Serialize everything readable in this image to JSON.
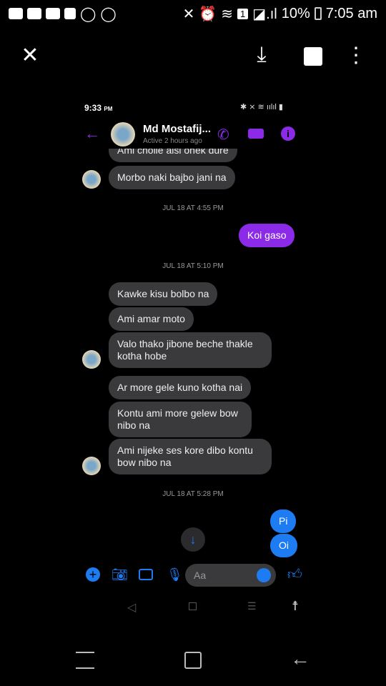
{
  "status_bar": {
    "time": "7:05 am",
    "battery": "10%",
    "sim": "1"
  },
  "viewer": {
    "close": "close-icon",
    "download": "download-icon",
    "layers": "layers-icon",
    "more": "more-icon"
  },
  "inner_status": {
    "time": "9:33",
    "ampm": "PM"
  },
  "header": {
    "name": "Md Mostafij...",
    "status": "Active 2 hours ago",
    "accent": "#8b2be8"
  },
  "messages": [
    {
      "side": "in",
      "text": "Ami choile aisi onek dure"
    },
    {
      "side": "in",
      "text": "Morbo naki bajbo jani na"
    },
    {
      "timestamp": "JUL 18 AT 4:55 PM"
    },
    {
      "side": "out",
      "text": "Koi gaso"
    },
    {
      "timestamp": "JUL 18 AT 5:10 PM"
    },
    {
      "side": "in",
      "text": "Kawke kisu bolbo na"
    },
    {
      "side": "in",
      "text": "Ami amar moto"
    },
    {
      "side": "in",
      "text": "Valo thako jibone beche thakle kotha hobe"
    },
    {
      "side": "in",
      "text": "Ar more gele kuno kotha nai"
    },
    {
      "side": "in",
      "text": "Kontu ami more gelew bow nibo na"
    },
    {
      "side": "in",
      "text": "Ami nijeke ses kore dibo kontu bow nibo na"
    },
    {
      "timestamp": "JUL 18 AT 5:28 PM"
    },
    {
      "side": "out",
      "text": "Pi"
    },
    {
      "side": "out",
      "text": "Oi"
    }
  ],
  "composer": {
    "placeholder": "Aa",
    "blue": "#1e7cf2"
  }
}
